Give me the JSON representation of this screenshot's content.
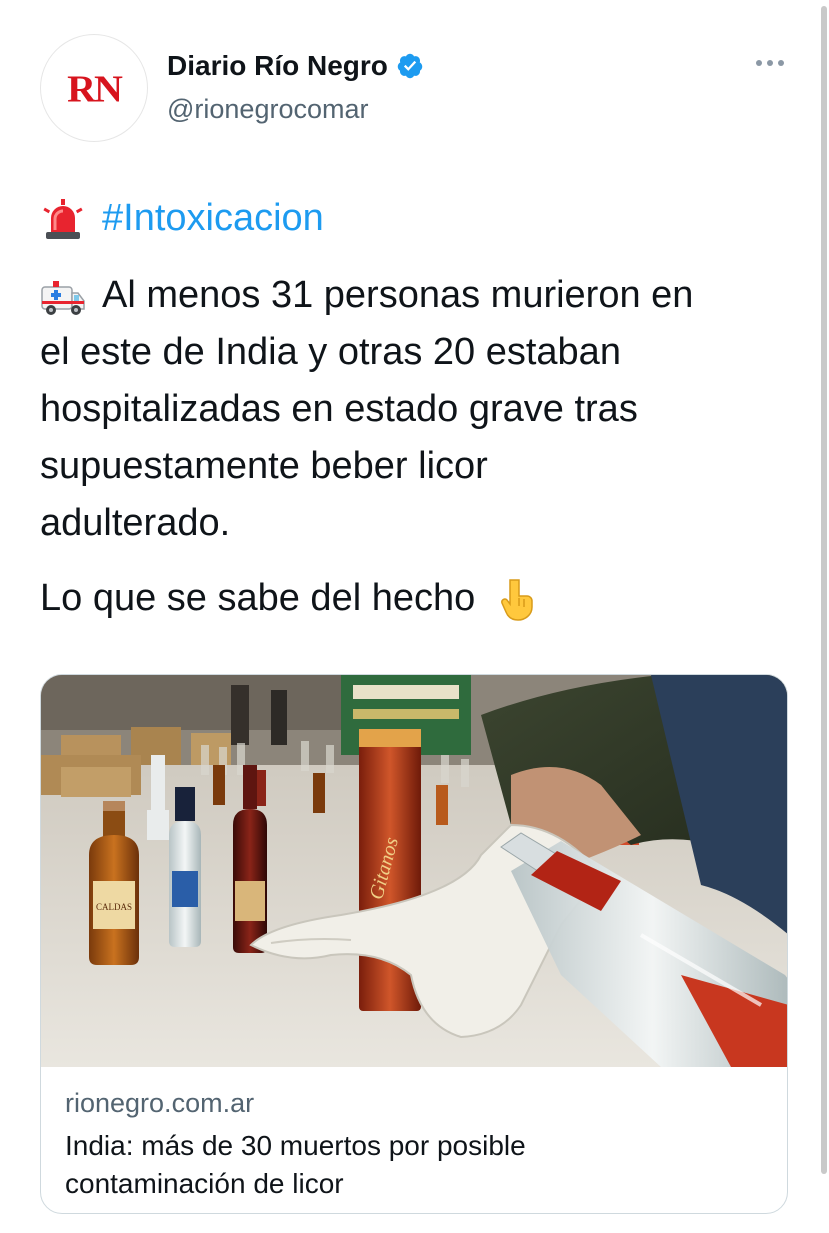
{
  "author": {
    "display_name": "Diario Río Negro",
    "handle": "@rionegrocomar",
    "avatar_text": "RN",
    "verified": true,
    "avatar_color": "#d7141e"
  },
  "menu": {
    "icon": "more-horizontal-icon"
  },
  "tweet": {
    "line1_emoji": "rotating-light-icon",
    "hashtag": "#Intoxicacion",
    "para1_emoji": "ambulance-icon",
    "para1_lines": [
      "Al menos 31 personas murieron en",
      "el este de India y otras 20 estaban",
      "hospitalizadas en estado grave tras",
      "supuestamente beber licor",
      "adulterado."
    ],
    "para2_text": "Lo que se sabe del hecho",
    "para2_emoji": "pointing-down-icon"
  },
  "card": {
    "domain": "rionegro.com.ar",
    "title_lines": [
      "India: más de 30 muertos por posible",
      "contaminación de licor"
    ],
    "image": "liquor-bottles-photo",
    "bottle_labels": {
      "large_bottle": "Gitanos",
      "bottles": "CALDAS"
    }
  },
  "colors": {
    "link": "#1d9bf0",
    "text": "#0f1419",
    "secondary": "#536471",
    "verified": "#1d9bf0"
  }
}
